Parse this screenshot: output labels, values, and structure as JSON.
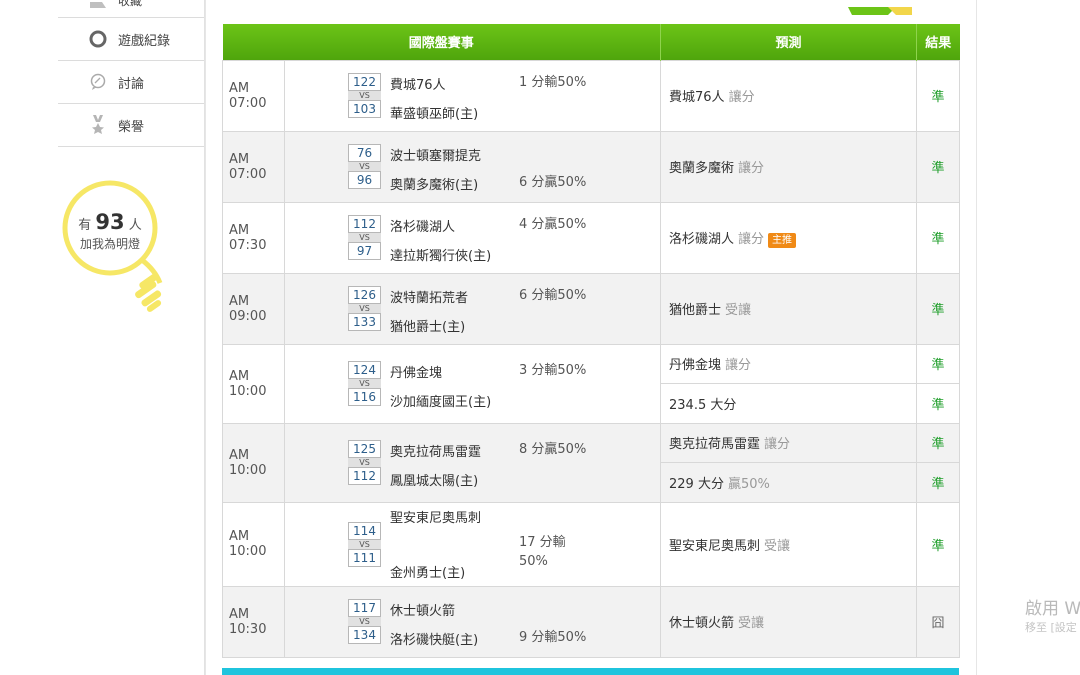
{
  "sidebar": {
    "items": [
      {
        "label": "收藏",
        "icon": "megaphone-icon"
      },
      {
        "label": "遊戲紀錄",
        "icon": "circle-icon"
      },
      {
        "label": "討論",
        "icon": "chat-icon"
      },
      {
        "label": "榮譽",
        "icon": "medal-icon"
      }
    ],
    "fans_prefix": "有",
    "fans_count": "93",
    "fans_suffix": "人",
    "fans_caption": "加我為明燈"
  },
  "table": {
    "headers": {
      "match": "國際盤賽事",
      "prediction": "預測",
      "result": "結果"
    },
    "games": [
      {
        "time": "AM 07:00",
        "away_score": "122",
        "home_score": "103",
        "away": "費城76人",
        "home": "華盛頓巫師(主)",
        "spread": "1 分輸50%",
        "spread_row": "away",
        "preds": [
          {
            "main": "費城76人",
            "sub": "讓分",
            "result": "準"
          }
        ]
      },
      {
        "time": "AM 07:00",
        "away_score": "76",
        "home_score": "96",
        "away": "波士頓塞爾提克",
        "home": "奧蘭多魔術(主)",
        "spread": "6 分贏50%",
        "spread_row": "home",
        "preds": [
          {
            "main": "奧蘭多魔術",
            "sub": "讓分",
            "result": "準"
          }
        ]
      },
      {
        "time": "AM 07:30",
        "away_score": "112",
        "home_score": "97",
        "away": "洛杉磯湖人",
        "home": "達拉斯獨行俠(主)",
        "spread": "4 分贏50%",
        "spread_row": "away",
        "preds": [
          {
            "main": "洛杉磯湖人",
            "sub": "讓分",
            "badge": "主推",
            "result": "準"
          }
        ]
      },
      {
        "time": "AM 09:00",
        "away_score": "126",
        "home_score": "133",
        "away": "波特蘭拓荒者",
        "home": "猶他爵士(主)",
        "spread": "6 分輸50%",
        "spread_row": "away",
        "preds": [
          {
            "main": "猶他爵士",
            "sub": "受讓",
            "result": "準"
          }
        ]
      },
      {
        "time": "AM 10:00",
        "away_score": "124",
        "home_score": "116",
        "away": "丹佛金塊",
        "home": "沙加緬度國王(主)",
        "spread": "3 分輸50%",
        "spread_row": "away",
        "preds": [
          {
            "main": "丹佛金塊",
            "sub": "讓分",
            "result": "準"
          },
          {
            "main": "234.5 大分",
            "sub": "",
            "result": "準"
          }
        ]
      },
      {
        "time": "AM 10:00",
        "away_score": "125",
        "home_score": "112",
        "away": "奧克拉荷馬雷霆",
        "home": "鳳凰城太陽(主)",
        "spread": "8 分贏50%",
        "spread_row": "away",
        "preds": [
          {
            "main": "奧克拉荷馬雷霆",
            "sub": "讓分",
            "result": "準"
          },
          {
            "main": "229 大分",
            "sub": "贏50%",
            "result": "準"
          }
        ]
      },
      {
        "time": "AM 10:00",
        "away_score": "114",
        "home_score": "111",
        "away": "聖安東尼奧馬刺",
        "home": "金州勇士(主)",
        "spread": "17 分輸 50%",
        "spread_row": "wrap",
        "preds": [
          {
            "main": "聖安東尼奧馬刺",
            "sub": "受讓",
            "result": "準"
          }
        ]
      },
      {
        "time": "AM 10:30",
        "away_score": "117",
        "home_score": "134",
        "away": "休士頓火箭",
        "home": "洛杉磯快艇(主)",
        "spread": "9 分輸50%",
        "spread_row": "home",
        "preds": [
          {
            "main": "休士頓火箭",
            "sub": "受讓",
            "result": "囧"
          }
        ]
      }
    ]
  },
  "overlay": {
    "line1": "啟用 W",
    "line2": "移至 [設定"
  }
}
